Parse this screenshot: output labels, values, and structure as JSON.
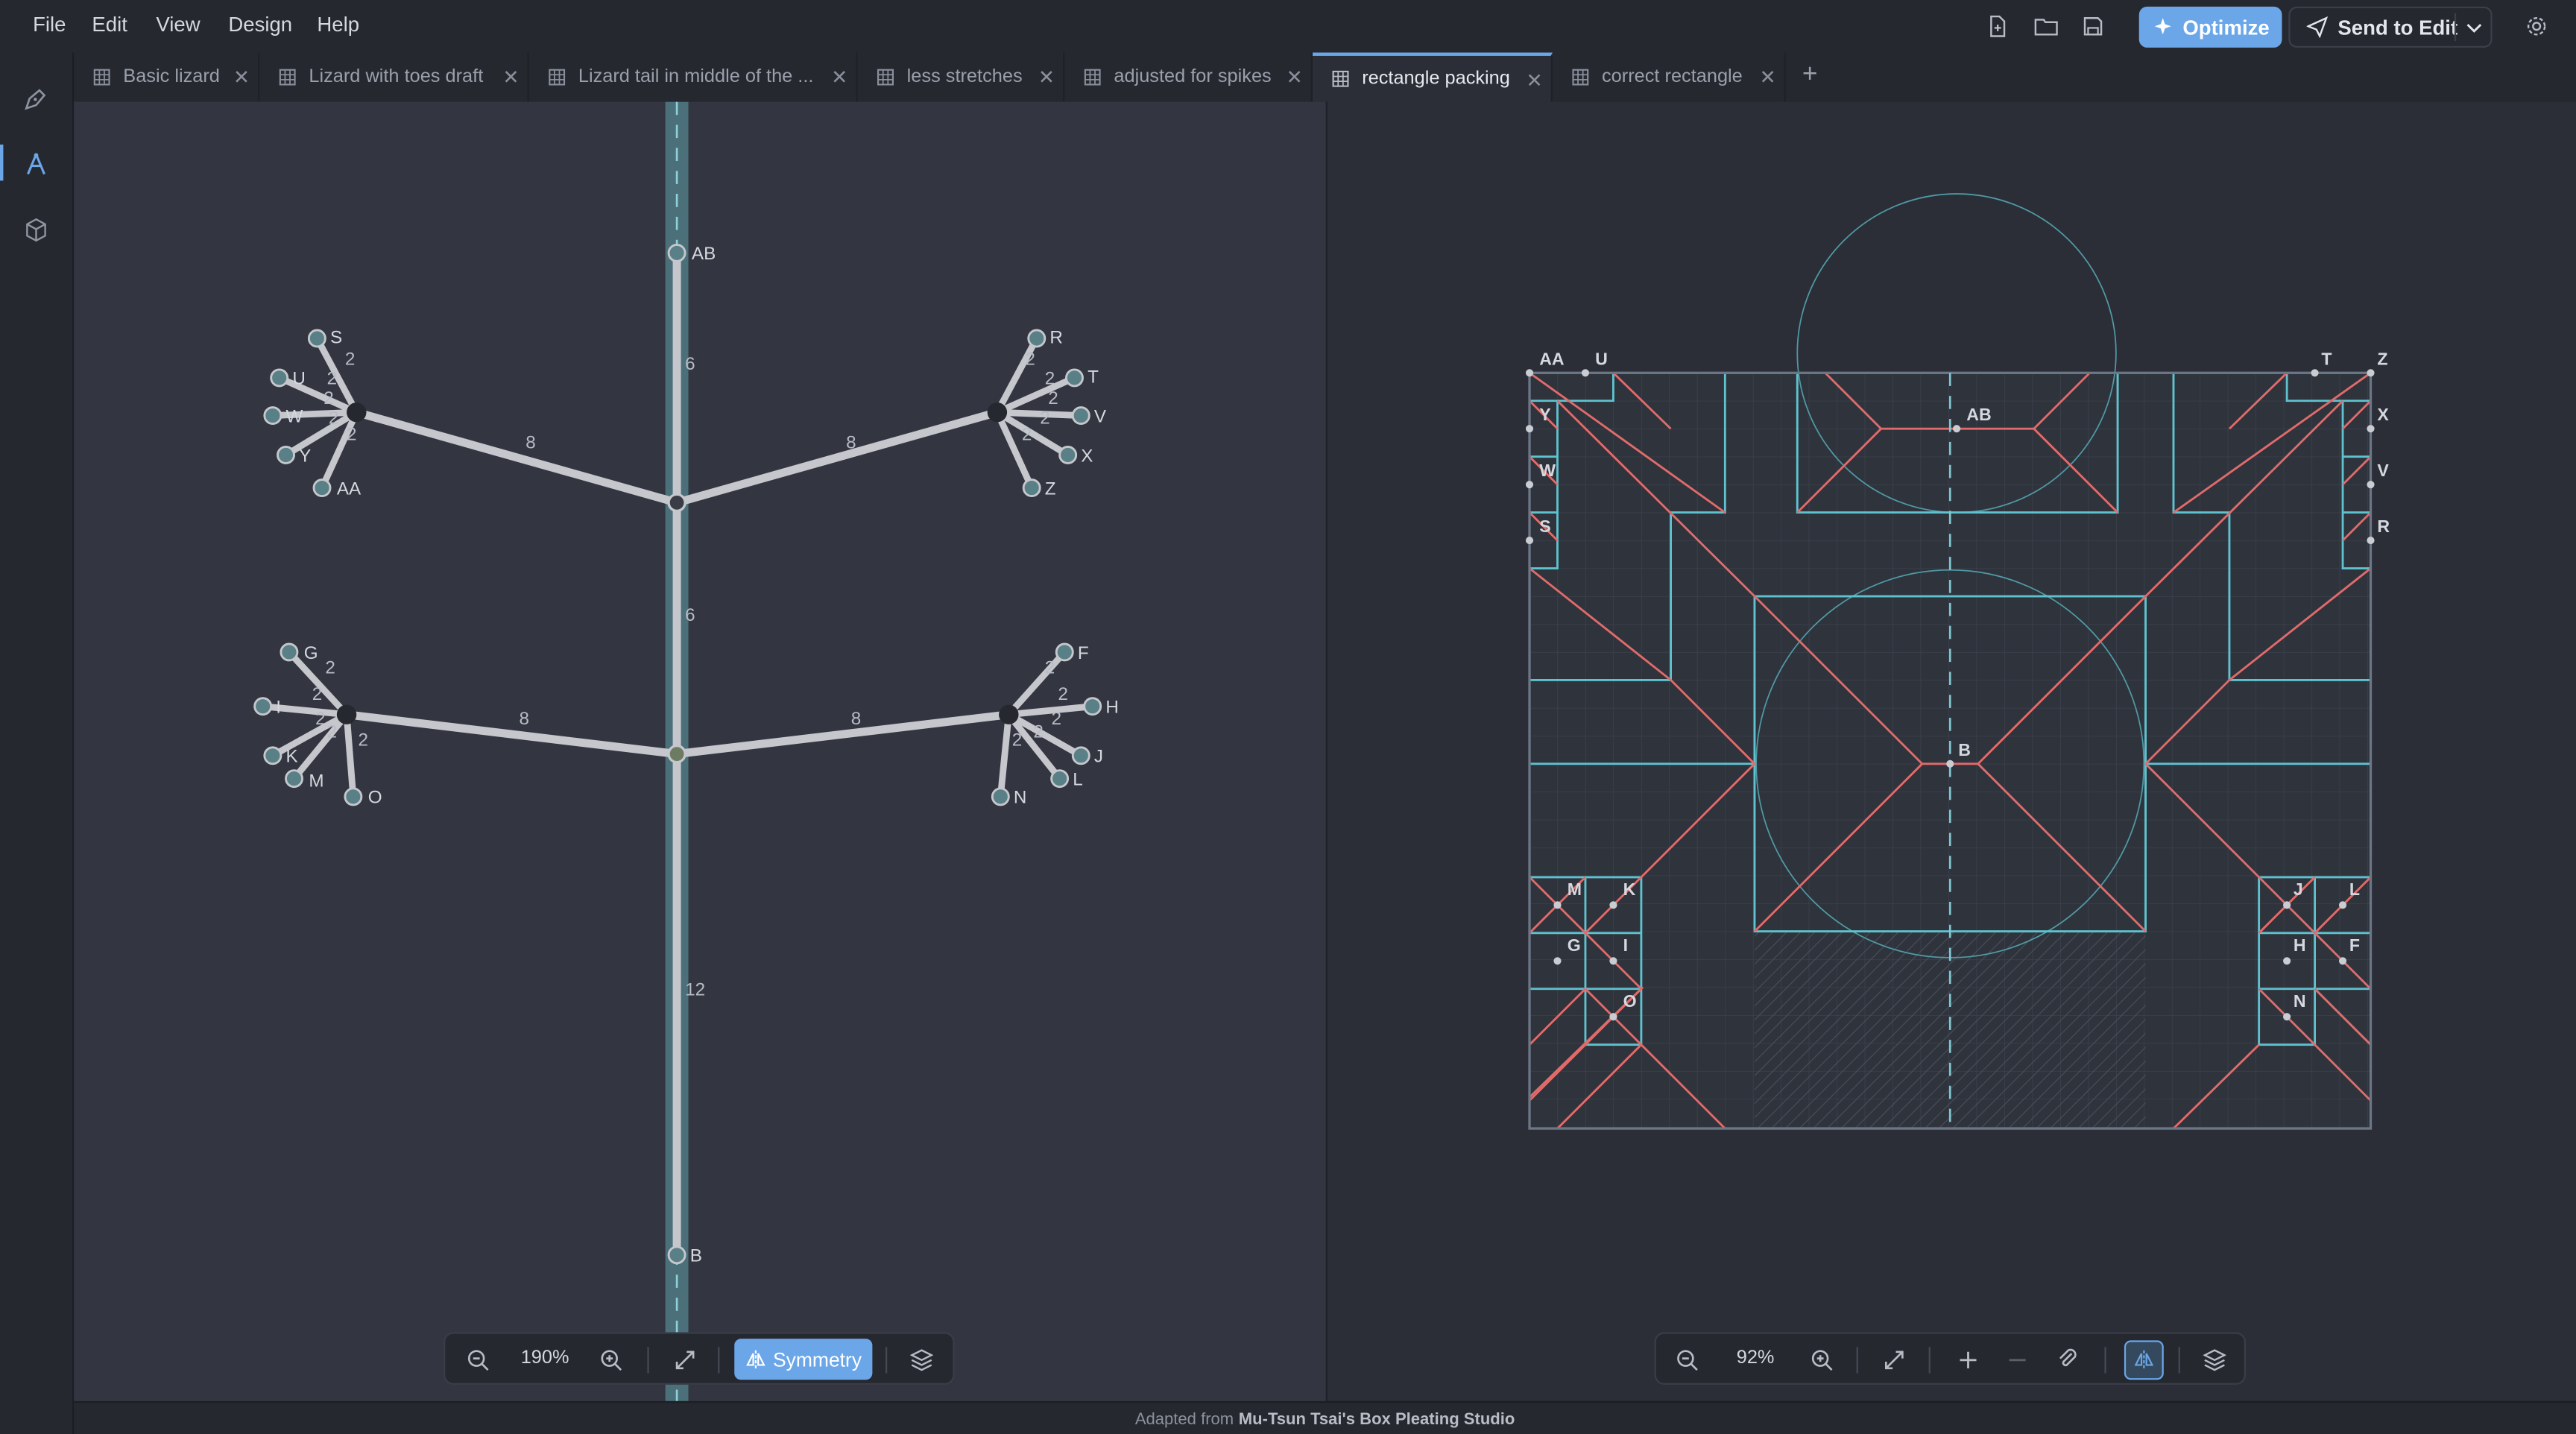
{
  "menu": {
    "file": "File",
    "edit": "Edit",
    "view": "View",
    "design": "Design",
    "help": "Help"
  },
  "toolbar": {
    "optimize_label": "Optimize",
    "send_label": "Send to Edit"
  },
  "tabs": [
    {
      "label": "Basic lizard"
    },
    {
      "label": "Lizard with toes draft"
    },
    {
      "label": "Lizard tail in middle of the ..."
    },
    {
      "label": "less stretches"
    },
    {
      "label": "adjusted for spikes"
    },
    {
      "label": "rectangle packing"
    },
    {
      "label": "correct rectangle"
    }
  ],
  "tree": {
    "edge_lengths": {
      "upper_spine": "6",
      "middle_spine": "6",
      "lower_spine": "12",
      "arm": "8",
      "toe": "2"
    },
    "node_labels": {
      "AB": "AB",
      "B": "B",
      "S": "S",
      "U": "U",
      "W": "W",
      "Y": "Y",
      "AA": "AA",
      "R": "R",
      "T": "T",
      "V": "V",
      "X": "X",
      "Z": "Z",
      "G": "G",
      "I": "I",
      "K": "K",
      "M": "M",
      "O": "O",
      "F": "F",
      "H": "H",
      "J": "J",
      "L": "L",
      "N": "N"
    }
  },
  "left_zoom": {
    "value": "190%",
    "symmetry_label": "Symmetry"
  },
  "right_zoom": {
    "value": "92%"
  },
  "cp_labels": {
    "AA": "AA",
    "U": "U",
    "T": "T",
    "Z": "Z",
    "Y": "Y",
    "X": "X",
    "W": "W",
    "V": "V",
    "S": "S",
    "R": "R",
    "AB": "AB",
    "B": "B",
    "M": "M",
    "K": "K",
    "G": "G",
    "I": "I",
    "O": "O",
    "J": "J",
    "L": "L",
    "H": "H",
    "F": "F",
    "N": "N"
  },
  "status": {
    "prefix": "Adapted from",
    "credit": "Mu-Tsun Tsai's Box Pleating Studio"
  },
  "colors": {
    "accent": "#6aa6e8",
    "crease_mountain": "#e06b6b",
    "crease_valley": "#5fc2cf",
    "tree_edge": "#c5c7cc",
    "node": "#5a8087"
  }
}
